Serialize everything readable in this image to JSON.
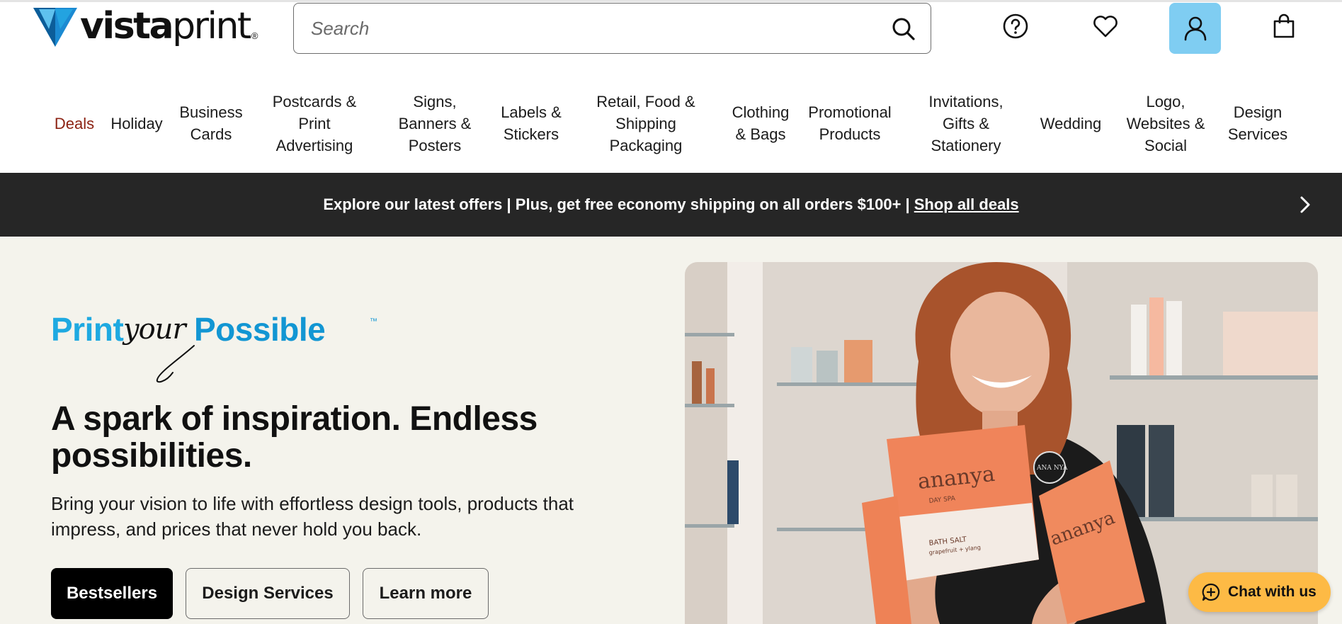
{
  "header": {
    "logo_text_bold": "vista",
    "logo_text_light": "print",
    "logo_registered": "®",
    "search_placeholder": "Search",
    "icons": [
      "search-icon",
      "help-icon",
      "heart-icon",
      "account-icon",
      "cart-icon"
    ],
    "account_bg": "#7fcdf2"
  },
  "nav": {
    "items": [
      {
        "label": "Deals",
        "color": "#8c2213"
      },
      {
        "label": "Holiday"
      },
      {
        "label": "Business\nCards"
      },
      {
        "label": "Postcards &\nPrint\nAdvertising"
      },
      {
        "label": "Signs,\nBanners &\nPosters"
      },
      {
        "label": "Labels &\nStickers"
      },
      {
        "label": "Retail, Food &\nShipping\nPackaging"
      },
      {
        "label": "Clothing\n& Bags"
      },
      {
        "label": "Promotional\nProducts"
      },
      {
        "label": "Invitations,\nGifts &\nStationery"
      },
      {
        "label": "Wedding"
      },
      {
        "label": "Logo,\nWebsites &\nSocial"
      },
      {
        "label": "Design\nServices"
      }
    ]
  },
  "banner": {
    "text": "Explore our latest offers | Plus, get free economy shipping on all orders $100+ |",
    "link": "Shop all deals",
    "bg": "#262626"
  },
  "hero": {
    "tagline": {
      "part1": "Print",
      "part2": "your",
      "part3": "Possible",
      "tm": "™"
    },
    "headline": "A spark of inspiration. Endless possibilities.",
    "subtext": "Bring your vision to life with effortless design tools, products that impress, and prices that never hold you back.",
    "buttons": {
      "bestsellers": "Bestsellers",
      "design_services": "Design Services",
      "learn_more": "Learn more"
    },
    "bg": "#f4f3ec",
    "image_text": {
      "brand": "ananya",
      "brand_sub": "DAY SPA",
      "product": "BATH SALT",
      "product_sub": "grapefruit + ylang",
      "badge": "ANA NYA"
    }
  },
  "chat": {
    "label": "Chat with us",
    "bg": "#fdba45"
  }
}
